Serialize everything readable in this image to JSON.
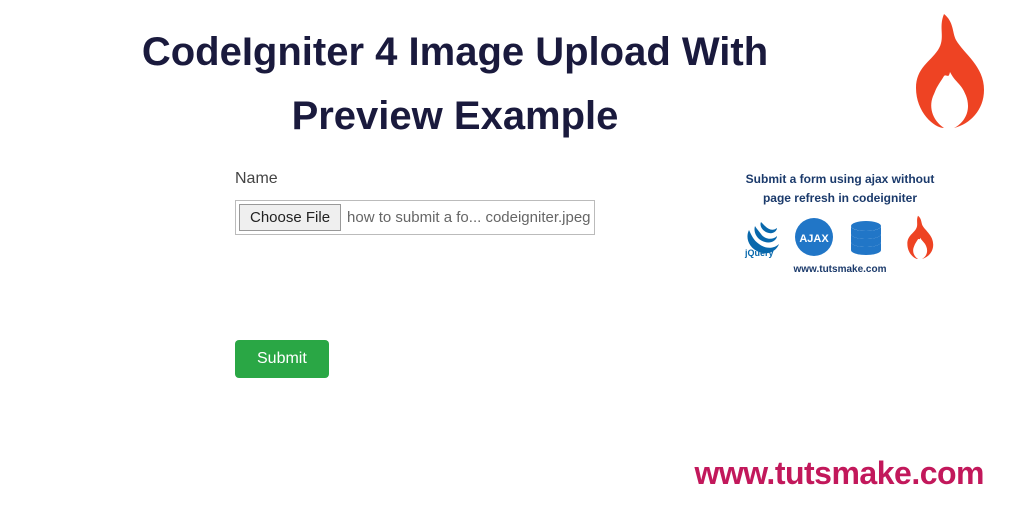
{
  "title": "CodeIgniter 4 Image Upload With Preview Example",
  "form": {
    "name_label": "Name",
    "choose_file_label": "Choose File",
    "selected_file": "how to submit a fo... codeigniter.jpeg",
    "submit_label": "Submit"
  },
  "preview": {
    "heading_line1": "Submit a form using ajax without",
    "heading_line2": "page refresh in codeigniter",
    "footer": "www.tutsmake.com",
    "icons": [
      "jquery",
      "ajax",
      "database",
      "codeigniter"
    ]
  },
  "watermark": "www.tutsmake.com"
}
